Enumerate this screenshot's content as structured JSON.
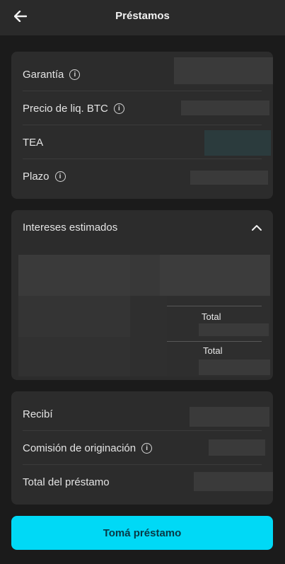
{
  "header": {
    "title": "Préstamos"
  },
  "summary": {
    "rows": [
      {
        "label": "Garantía",
        "has_info": true
      },
      {
        "label": "Precio de liq. BTC",
        "has_info": true
      },
      {
        "label": "TEA",
        "has_info": false
      },
      {
        "label": "Plazo",
        "has_info": true
      }
    ]
  },
  "interest": {
    "title": "Intereses estimados",
    "total_labels": [
      "Total",
      "Total"
    ]
  },
  "breakdown": {
    "rows": [
      {
        "label": "Recibí",
        "has_info": false
      },
      {
        "label": "Comisión de originación",
        "has_info": true
      },
      {
        "label": "Total del préstamo",
        "has_info": false
      }
    ]
  },
  "cta": {
    "label": "Tomá préstamo"
  },
  "colors": {
    "accent": "#00d9f6",
    "background": "#1b1b1b",
    "card": "#2c2c2c"
  }
}
